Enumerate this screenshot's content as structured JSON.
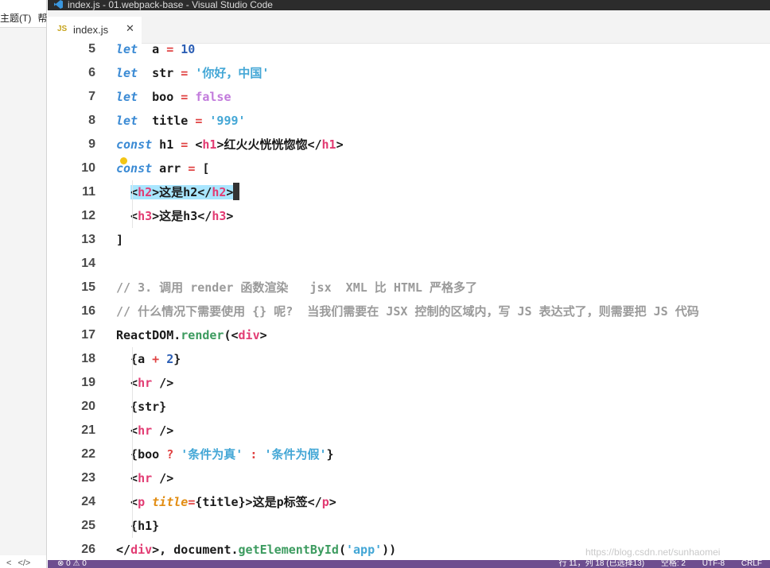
{
  "window": {
    "title": "index.js - 01.webpack-base - Visual Studio Code"
  },
  "left_menu": {
    "items": [
      "主题(T)",
      "帮"
    ]
  },
  "left_footer": {
    "back": "<",
    "code": "</>"
  },
  "tab": {
    "icon": "JS",
    "label": "index.js",
    "close": "✕"
  },
  "status": {
    "left": "⊗ 0  ⚠ 0",
    "position": "行 11，列 18 (已选择13)",
    "spaces": "空格: 2",
    "encoding": "UTF-8",
    "eol": "CRLF"
  },
  "watermark": "https://blog.csdn.net/sunhaomei",
  "colors": {
    "status_bar": "#6e4e8f",
    "selection": "#a9e6ff",
    "keyword": "#3a8ad4"
  },
  "code_lines": [
    {
      "n": "5",
      "tokens": [
        [
          "kw",
          "let"
        ],
        [
          "",
          "  a "
        ],
        [
          "op",
          "="
        ],
        [
          "",
          " "
        ],
        [
          "num",
          "10"
        ]
      ]
    },
    {
      "n": "6",
      "tokens": [
        [
          "kw",
          "let"
        ],
        [
          "",
          "  str "
        ],
        [
          "op",
          "="
        ],
        [
          "",
          " "
        ],
        [
          "str",
          "'你好，中国'"
        ]
      ]
    },
    {
      "n": "7",
      "tokens": [
        [
          "kw",
          "let"
        ],
        [
          "",
          "  boo "
        ],
        [
          "op",
          "="
        ],
        [
          "",
          " "
        ],
        [
          "bool",
          "false"
        ]
      ]
    },
    {
      "n": "8",
      "tokens": [
        [
          "kw",
          "let"
        ],
        [
          "",
          "  title "
        ],
        [
          "op",
          "="
        ],
        [
          "",
          " "
        ],
        [
          "str",
          "'999'"
        ]
      ]
    },
    {
      "n": "9",
      "tokens": [
        [
          "kw",
          "const"
        ],
        [
          "",
          " h1 "
        ],
        [
          "op",
          "="
        ],
        [
          "",
          " <"
        ],
        [
          "tag",
          "h1"
        ],
        [
          "",
          ">红火火恍恍惚惚</"
        ],
        [
          "tag",
          "h1"
        ],
        [
          "",
          ">"
        ]
      ]
    },
    {
      "n": "10",
      "tokens": [
        [
          "kw",
          "const"
        ],
        [
          "",
          " arr "
        ],
        [
          "op",
          "="
        ],
        [
          "",
          " ["
        ]
      ]
    },
    {
      "n": "11",
      "tokens": [
        [
          "",
          "  "
        ],
        [
          "sel-open",
          ""
        ],
        [
          "",
          "<"
        ],
        [
          "tag",
          "h2"
        ],
        [
          "",
          ">这是h2</"
        ],
        [
          "tag",
          "h2"
        ],
        [
          "",
          ">"
        ],
        [
          "sel-close",
          ""
        ],
        [
          "caret",
          ""
        ]
      ]
    },
    {
      "n": "12",
      "tokens": [
        [
          "",
          "  <"
        ],
        [
          "tag",
          "h3"
        ],
        [
          "",
          ">这是h3</"
        ],
        [
          "tag",
          "h3"
        ],
        [
          "",
          ">"
        ]
      ]
    },
    {
      "n": "13",
      "tokens": [
        [
          "",
          "]"
        ]
      ]
    },
    {
      "n": "14",
      "tokens": []
    },
    {
      "n": "15",
      "tokens": [
        [
          "cmt",
          "// 3. 调用 render 函数渲染   jsx  XML 比 HTML 严格多了"
        ]
      ]
    },
    {
      "n": "16",
      "tokens": [
        [
          "cmt",
          "// 什么情况下需要使用 {} 呢?  当我们需要在 JSX 控制的区域内，写 JS 表达式了，则需要把 JS 代码"
        ]
      ]
    },
    {
      "n": "17",
      "tokens": [
        [
          "",
          "ReactDOM."
        ],
        [
          "fn",
          "render"
        ],
        [
          "",
          "(<"
        ],
        [
          "tag",
          "div"
        ],
        [
          "",
          ">"
        ]
      ]
    },
    {
      "n": "18",
      "tokens": [
        [
          "",
          "  {a "
        ],
        [
          "op",
          "+"
        ],
        [
          "",
          " "
        ],
        [
          "num",
          "2"
        ],
        [
          "",
          "}"
        ]
      ]
    },
    {
      "n": "19",
      "tokens": [
        [
          "",
          "  <"
        ],
        [
          "tag",
          "hr"
        ],
        [
          "",
          " />"
        ]
      ]
    },
    {
      "n": "20",
      "tokens": [
        [
          "",
          "  {str}"
        ]
      ]
    },
    {
      "n": "21",
      "tokens": [
        [
          "",
          "  <"
        ],
        [
          "tag",
          "hr"
        ],
        [
          "",
          " />"
        ]
      ]
    },
    {
      "n": "22",
      "tokens": [
        [
          "",
          "  {boo "
        ],
        [
          "op",
          "?"
        ],
        [
          "",
          " "
        ],
        [
          "str",
          "'条件为真'"
        ],
        [
          "",
          " "
        ],
        [
          "op",
          ":"
        ],
        [
          "",
          " "
        ],
        [
          "str",
          "'条件为假'"
        ],
        [
          "",
          "}"
        ]
      ]
    },
    {
      "n": "23",
      "tokens": [
        [
          "",
          "  <"
        ],
        [
          "tag",
          "hr"
        ],
        [
          "",
          " />"
        ]
      ]
    },
    {
      "n": "24",
      "tokens": [
        [
          "",
          "  <"
        ],
        [
          "tag",
          "p"
        ],
        [
          "",
          " "
        ],
        [
          "attr",
          "title"
        ],
        [
          "op",
          "="
        ],
        [
          "",
          "{title}>这是p标签</"
        ],
        [
          "tag",
          "p"
        ],
        [
          "",
          ">"
        ]
      ]
    },
    {
      "n": "25",
      "tokens": [
        [
          "",
          "  {h1}"
        ]
      ]
    },
    {
      "n": "26",
      "tokens": [
        [
          "",
          "</"
        ],
        [
          "tag",
          "div"
        ],
        [
          "",
          ">, document."
        ],
        [
          "fn",
          "getElementById"
        ],
        [
          "",
          "("
        ],
        [
          "str",
          "'app'"
        ],
        [
          "",
          "))"
        ]
      ]
    }
  ]
}
